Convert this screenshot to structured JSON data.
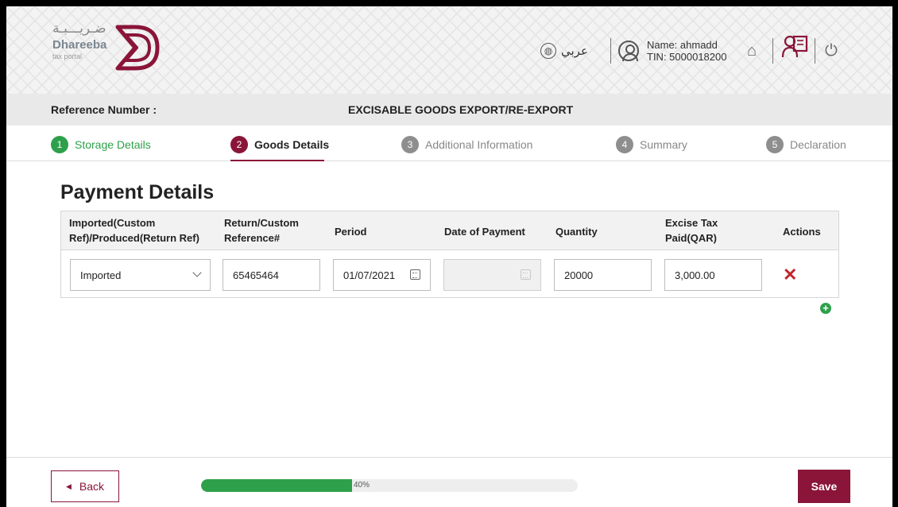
{
  "header": {
    "logo": {
      "arabic": "ضـريـــبـة",
      "name": "Dhareeba",
      "tagline": "tax portal"
    },
    "language_label": "عربي",
    "user_name": "Name: ahmadd",
    "user_tin": "TIN: 5000018200"
  },
  "reference": {
    "label": "Reference Number :",
    "form_title": "EXCISABLE GOODS EXPORT/RE-EXPORT"
  },
  "steps": [
    {
      "num": "1",
      "label": "Storage Details",
      "state": "done"
    },
    {
      "num": "2",
      "label": "Goods Details",
      "state": "active"
    },
    {
      "num": "3",
      "label": "Additional Information",
      "state": "pending"
    },
    {
      "num": "4",
      "label": "Summary",
      "state": "pending"
    },
    {
      "num": "5",
      "label": "Declaration",
      "state": "pending"
    }
  ],
  "payment": {
    "title": "Payment Details",
    "columns": [
      {
        "line1": "Imported(Custom",
        "line2": "Ref)/Produced(Return Ref)"
      },
      {
        "line1": "Return/Custom",
        "line2": "Reference#"
      },
      {
        "line1": "Period",
        "line2": ""
      },
      {
        "line1": "Date of Payment",
        "line2": ""
      },
      {
        "line1": "Quantity",
        "line2": ""
      },
      {
        "line1": "Excise Tax",
        "line2": "Paid(QAR)"
      },
      {
        "line1": "Actions",
        "line2": ""
      }
    ],
    "row": {
      "type": "Imported",
      "reference": "65465464",
      "period": "01/07/2021",
      "date_of_payment": "",
      "quantity": "20000",
      "tax_paid": "3,000.00"
    }
  },
  "footer": {
    "back_label": "Back",
    "progress_text": "40%",
    "progress_value": 0.4,
    "save_label": "Save"
  },
  "colors": {
    "primary": "#8a1538",
    "success": "#2ea04b",
    "danger": "#c0262d"
  }
}
